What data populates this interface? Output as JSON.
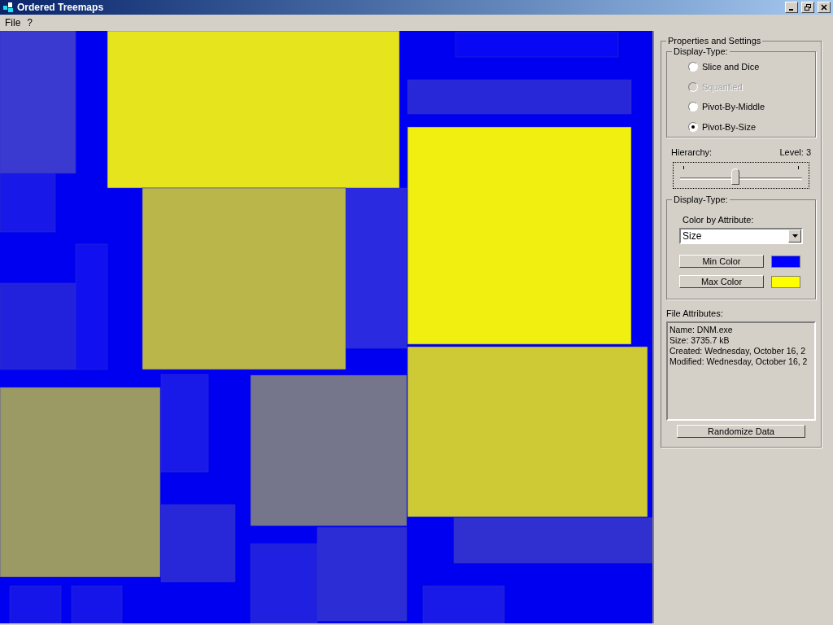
{
  "window": {
    "title": "Ordered Treemaps"
  },
  "menu": [
    {
      "label": "File"
    },
    {
      "label": "?"
    }
  ],
  "properties": {
    "title": "Properties and Settings",
    "display_type": {
      "title": "Display-Type:",
      "options": [
        {
          "label": "Slice and Dice",
          "selected": false,
          "disabled": false
        },
        {
          "label": "Squarified",
          "selected": false,
          "disabled": true
        },
        {
          "label": "Pivot-By-Middle",
          "selected": false,
          "disabled": false
        },
        {
          "label": "Pivot-By-Size",
          "selected": true,
          "disabled": false
        }
      ]
    },
    "hierarchy": {
      "label": "Hierarchy:",
      "reading": "Level: 3",
      "level": 0.45
    },
    "coloring": {
      "title": "Display-Type:",
      "attribute_label": "Color by Attribute:",
      "attribute_value": "Size",
      "color_buttons": [
        {
          "label": "Min Color",
          "color": "#0000ff"
        },
        {
          "label": "Max Color",
          "color": "#ffff00"
        }
      ]
    },
    "file_attributes": {
      "label": "File Attributes:",
      "lines": [
        "Name: DNM.exe",
        "Size: 3735.7 kB",
        "Created: Wednesday, October 16, 2",
        "Modified: Wednesday, October 16, 2"
      ]
    },
    "randomize_button": "Randomize Data"
  }
}
